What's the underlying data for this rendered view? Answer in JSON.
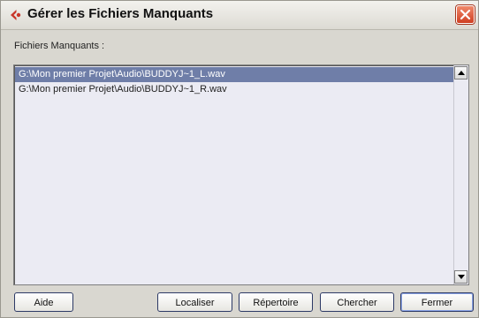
{
  "window": {
    "title": "Gérer les Fichiers Manquants"
  },
  "list": {
    "label": "Fichiers Manquants :",
    "items": [
      {
        "path": "G:\\Mon premier Projet\\Audio\\BUDDYJ~1_L.wav",
        "selected": true
      },
      {
        "path": "G:\\Mon premier Projet\\Audio\\BUDDYJ~1_R.wav",
        "selected": false
      }
    ]
  },
  "buttons": {
    "help": "Aide",
    "locate": "Localiser",
    "folder": "Répertoire",
    "search": "Chercher",
    "close": "Fermer"
  },
  "colors": {
    "selection": "#6f7ea8",
    "close_button": "#d9492b",
    "app_icon": "#c8362a"
  }
}
